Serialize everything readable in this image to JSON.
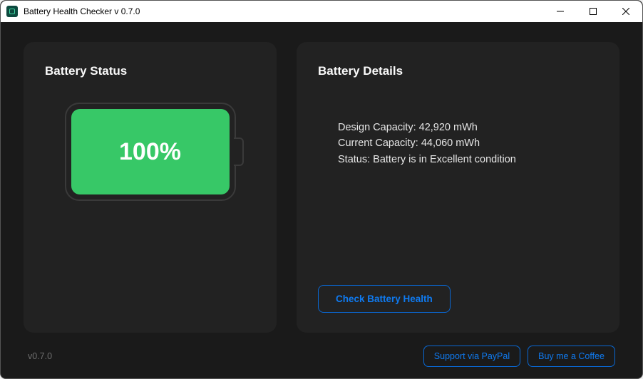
{
  "window": {
    "title": "Battery Health Checker v 0.7.0"
  },
  "status_card": {
    "title": "Battery Status",
    "percent": "100%"
  },
  "details_card": {
    "title": "Battery Details",
    "design_capacity": "Design Capacity: 42,920 mWh",
    "current_capacity": "Current Capacity: 44,060 mWh",
    "status_line": "Status: Battery is in Excellent condition",
    "check_button": "Check Battery Health"
  },
  "footer": {
    "version": "v0.7.0",
    "support_paypal": "Support via PayPal",
    "buy_coffee": "Buy me a Coffee"
  },
  "colors": {
    "accent": "#0f7af0",
    "battery_good": "#37c867"
  }
}
